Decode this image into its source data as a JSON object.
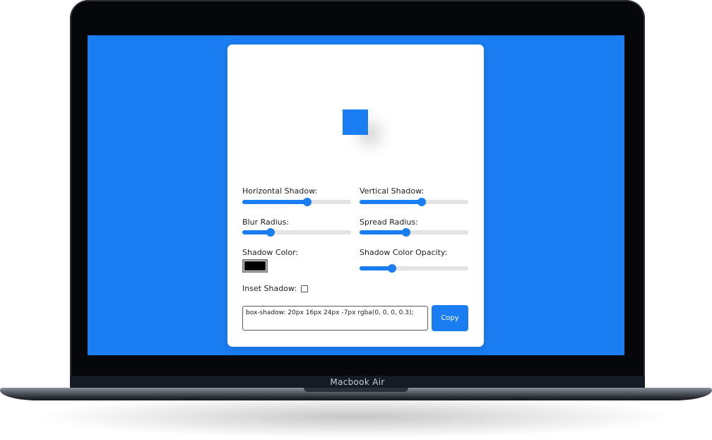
{
  "device": {
    "model_label": "Macbook Air"
  },
  "colors": {
    "accent": "#1a7df1",
    "screen_bg": "#1a7df1",
    "card_bg": "#ffffff",
    "shadow_color": "#000000"
  },
  "controls": {
    "horizontal_shadow": {
      "label": "Horizontal Shadow:",
      "value_fraction": 0.6
    },
    "vertical_shadow": {
      "label": "Vertical Shadow:",
      "value_fraction": 0.57
    },
    "blur_radius": {
      "label": "Blur Radius:",
      "value_fraction": 0.26
    },
    "spread_radius": {
      "label": "Spread Radius:",
      "value_fraction": 0.43
    },
    "shadow_color": {
      "label": "Shadow Color:",
      "value": "#000000"
    },
    "shadow_opacity": {
      "label": "Shadow Color Opacity:",
      "value_fraction": 0.3
    },
    "inset_shadow": {
      "label": "Inset Shadow:",
      "checked": false
    }
  },
  "output": {
    "code": "box-shadow: 20px 16px 24px -7px rgba(0, 0, 0, 0.3);",
    "copy_label": "Copy"
  }
}
